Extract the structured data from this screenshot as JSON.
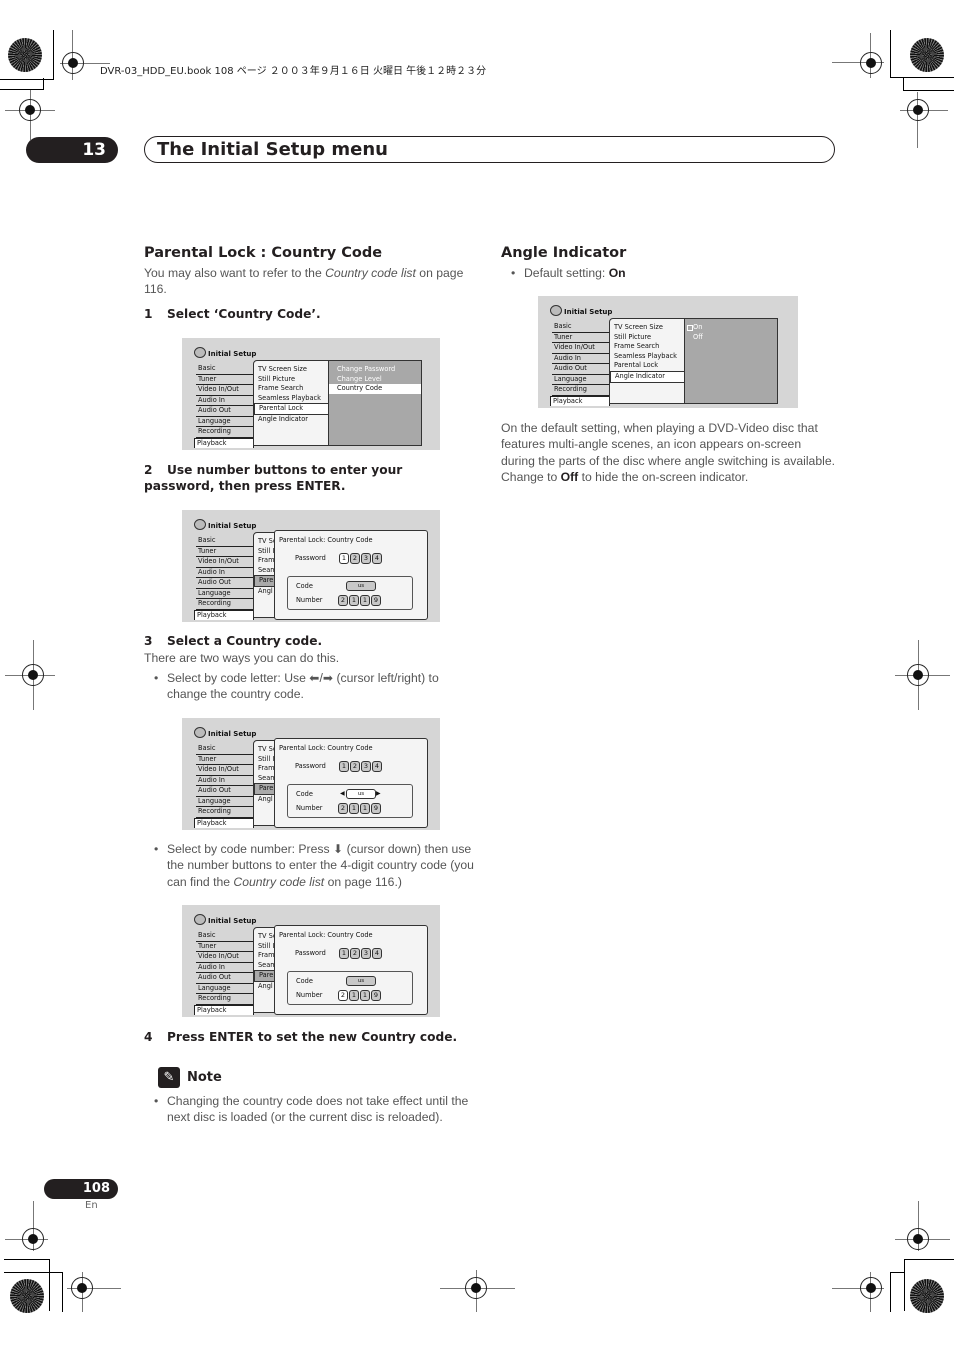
{
  "print_header": "DVR-03_HDD_EU.book  108 ページ  ２００３年９月１６日  火曜日  午後１２時２３分",
  "chapter": {
    "number": "13",
    "title": "The Initial Setup menu"
  },
  "left": {
    "heading": "Parental Lock : Country Code",
    "intro_pre": "You may also want to refer to the ",
    "intro_italic": "Country code list",
    "intro_post": " on page 116.",
    "step1": {
      "num": "1",
      "text": "Select ‘Country Code’."
    },
    "step2": {
      "num": "2",
      "text": "Use number buttons to enter your password, then press ENTER."
    },
    "step3": {
      "num": "3",
      "text": "Select a Country code.",
      "sub": "There are two ways you can do this."
    },
    "bullet_a": "Select by code letter: Use ⬅/➡ (cursor left/right) to change the country code.",
    "bullet_b_pre": "Select by code number: Press ⬇ (cursor down) then use the number buttons to enter the 4-digit country code (you can find the ",
    "bullet_b_italic": "Country code list",
    "bullet_b_post": " on page 116.)",
    "step4": {
      "num": "4",
      "text": "Press ENTER to set the new Country code."
    },
    "note_title": "Note",
    "note_text": "Changing the country code does not take effect until the next disc is loaded (or the current disc is reloaded)."
  },
  "right": {
    "heading": "Angle Indicator",
    "default_label": "Default setting: ",
    "default_value": "On",
    "para_pre": "On the default setting, when playing a DVD-Video disc that features multi-angle scenes, an icon appears on-screen during the parts of the disc where angle switching is available. Change to ",
    "para_bold": "Off",
    "para_post": " to hide the on-screen indicator."
  },
  "osd": {
    "title": "Initial Setup",
    "categories": [
      "Basic",
      "Tuner",
      "Video In/Out",
      "Audio In",
      "Audio Out",
      "Language",
      "Recording",
      "Playback"
    ],
    "playback_items": [
      "TV Screen Size",
      "Still Picture",
      "Frame Search",
      "Seamless Playback",
      "Parental Lock",
      "Angle Indicator"
    ],
    "parental_options": [
      "Change Password",
      "Change Level",
      "Country Code"
    ],
    "angle_options": [
      "On",
      "Off"
    ],
    "dialog_title": "Parental Lock: Country Code",
    "password_label": "Password",
    "password_digits": [
      "1",
      "2",
      "3",
      "4"
    ],
    "code_label": "Code",
    "code_value": "us",
    "number_label": "Number",
    "number_digits": [
      "2",
      "1",
      "1",
      "9"
    ],
    "mid_truncated": [
      "TV Sc",
      "Still I",
      "Fram",
      "Seam",
      "Paren",
      "Angl"
    ]
  },
  "footer": {
    "page": "108",
    "lang": "En"
  }
}
